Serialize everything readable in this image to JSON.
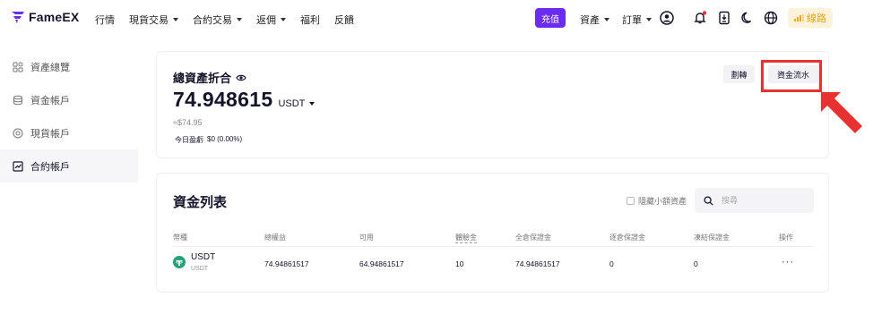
{
  "brand": {
    "name": "FameEX"
  },
  "nav": {
    "items": [
      {
        "label": "行情",
        "has_caret": false
      },
      {
        "label": "現貨交易",
        "has_caret": true
      },
      {
        "label": "合約交易",
        "has_caret": true
      },
      {
        "label": "返佣",
        "has_caret": true
      },
      {
        "label": "福利",
        "has_caret": false
      },
      {
        "label": "反饋",
        "has_caret": false
      }
    ],
    "deposit_label": "充值",
    "assets_label": "資產",
    "orders_label": "訂單",
    "line_label": "線路"
  },
  "sidebar": {
    "items": [
      {
        "label": "資產總覽",
        "icon": "grid-icon",
        "active": false
      },
      {
        "label": "資金帳戶",
        "icon": "database-icon",
        "active": false
      },
      {
        "label": "現貨帳戶",
        "icon": "target-icon",
        "active": false
      },
      {
        "label": "合約帳戶",
        "icon": "chart-icon",
        "active": true
      }
    ]
  },
  "summary": {
    "title": "總資產折合",
    "balance": "74.948615",
    "unit": "USDT",
    "approx": "≈$74.95",
    "pnl_label": "今日盈虧",
    "pnl_value": "$0 (0.00%)",
    "transfer_label": "劃轉",
    "flow_label": "資金流水"
  },
  "funds": {
    "title": "資金列表",
    "hide_small_label": "隱藏小額資產",
    "search_placeholder": "搜尋",
    "columns": [
      "幣種",
      "總權益",
      "可用",
      "體驗金",
      "全倉保證金",
      "逐倉保證金",
      "凍結保證金",
      "操作"
    ],
    "rows": [
      {
        "coin": "USDT",
        "coin_sub": "USDT",
        "equity": "74.94861517",
        "available": "64.94861517",
        "bonus": "10",
        "cross_margin": "74.94861517",
        "isolated_margin": "0",
        "frozen_margin": "0",
        "action": "···"
      }
    ]
  },
  "colors": {
    "accent": "#6a2cf0",
    "highlight": "#e83232",
    "usdt": "#26a17b",
    "line_gold": "#e8a318"
  }
}
